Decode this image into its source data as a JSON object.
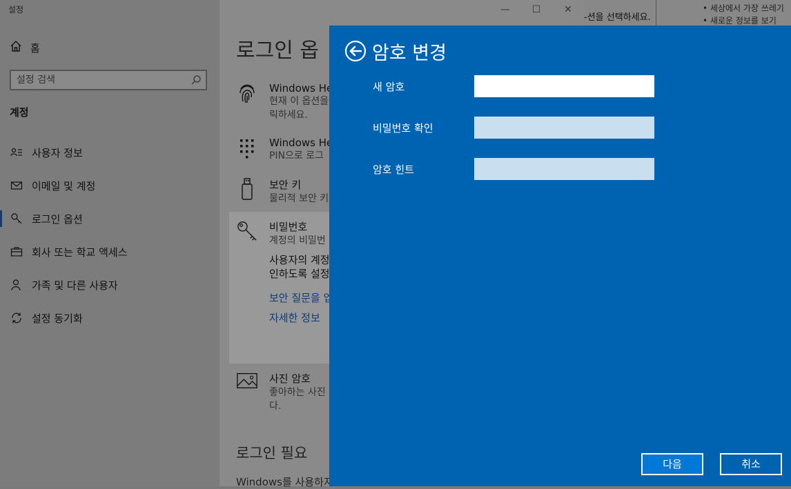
{
  "window": {
    "title": "설정",
    "controls": [
      "—",
      "☐",
      "✕"
    ]
  },
  "sidebar": {
    "home_label": "홈",
    "search_placeholder": "설정 검색",
    "section_title": "계정",
    "items": [
      {
        "label": "사용자 정보",
        "icon": "person-card-icon"
      },
      {
        "label": "이메일 및 계정",
        "icon": "mail-icon"
      },
      {
        "label": "로그인 옵션",
        "icon": "key-icon",
        "active": true
      },
      {
        "label": "회사 또는 학교 액세스",
        "icon": "briefcase-icon"
      },
      {
        "label": "가족 및 다른 사용자",
        "icon": "person-add-icon"
      },
      {
        "label": "설정 동기화",
        "icon": "sync-icon"
      }
    ]
  },
  "main": {
    "title": "로그인 옵",
    "options": [
      {
        "title": "Windows Hel",
        "desc1": "현재 이 옵션을",
        "desc2": "릭하세요.",
        "icon": "fingerprint-icon"
      },
      {
        "title": "Windows Hel",
        "desc1": "PIN으로 로그",
        "icon": "pin-keypad-icon"
      },
      {
        "title": "보안 키",
        "desc1": "물리적 보안 키",
        "icon": "usb-key-icon"
      },
      {
        "title": "비밀번호",
        "desc1": "계정의 비밀번",
        "icon": "password-key-icon"
      },
      {
        "title": "사진 암호",
        "desc1": "좋아하는 사진",
        "desc2": "다.",
        "icon": "picture-icon"
      }
    ],
    "password_expanded": {
      "text1": "사용자의 계정",
      "text2": "인하도록 설정",
      "link1": "보안 질문을 업",
      "link2": "자세한 정보"
    },
    "sub_heading": "로그인 필요",
    "footer_text": "Windows를 사용하지"
  },
  "background_window": {
    "text": "-션을 선택하세요.",
    "bullets": [
      "세상에서 가장 쓰레기",
      "새로운 정보를 보기"
    ]
  },
  "dialog": {
    "title": "암호 변경",
    "fields": [
      {
        "label": "새 암호",
        "value": ""
      },
      {
        "label": "비밀번호 확인",
        "value": ""
      },
      {
        "label": "암호 힌트",
        "value": ""
      }
    ],
    "next_label": "다음",
    "cancel_label": "취소",
    "colors": {
      "background": "#0063b1",
      "primary_button": "#0078d7",
      "inactive_field": "#c9dfef"
    }
  }
}
